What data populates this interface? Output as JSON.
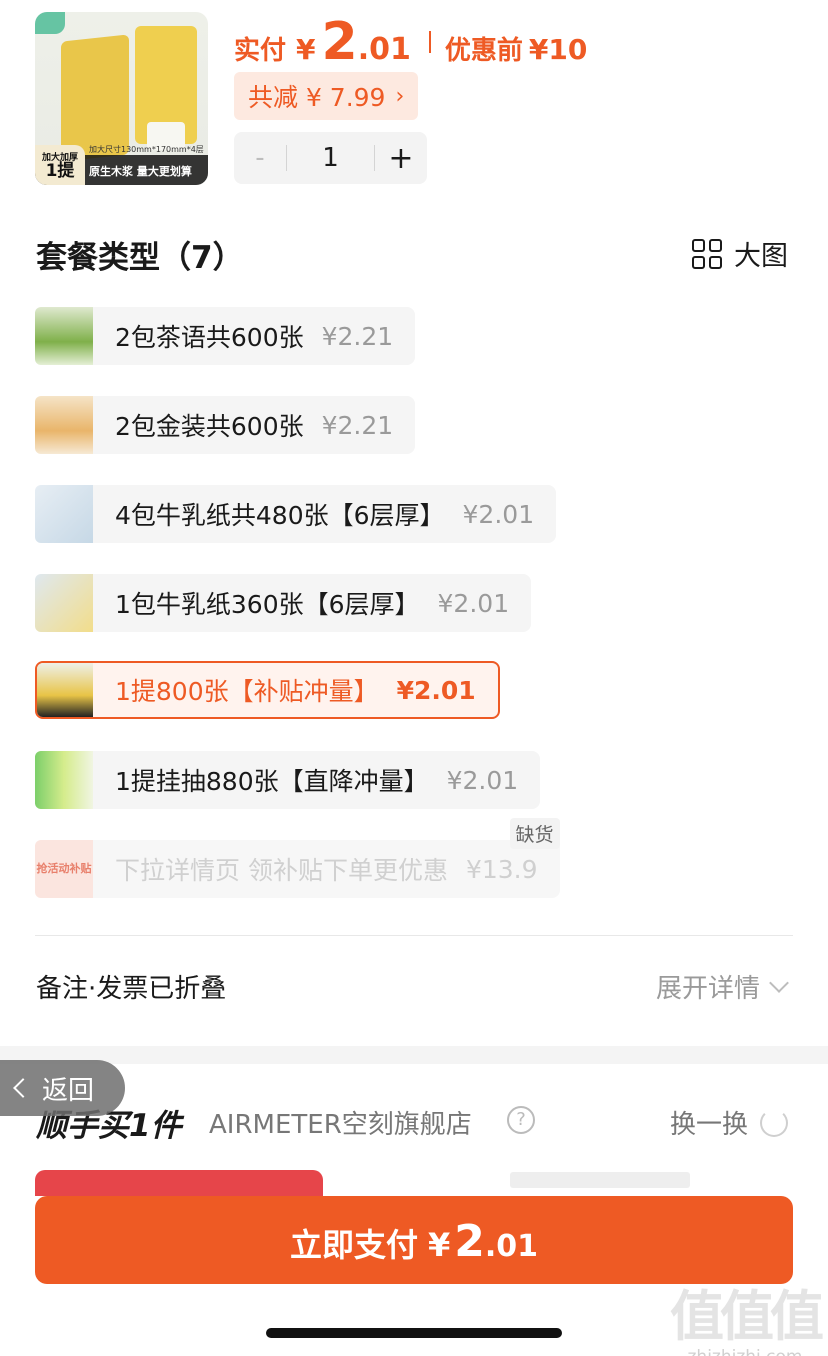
{
  "product": {
    "thumb_badge_small": "加大加厚",
    "thumb_badge_big": "1提",
    "thumb_size": "加大尺寸130mm*170mm*4层",
    "thumb_caption": "原生木浆 量大更划算"
  },
  "price": {
    "label": "实付",
    "currency": "¥",
    "integer": "2",
    "decimal": ".01",
    "original_label": "优惠前",
    "original_value": "¥10"
  },
  "discount": {
    "text": "共减 ¥ 7.99",
    "chevron": "›"
  },
  "stepper": {
    "minus": "-",
    "quantity": "1",
    "plus": "+"
  },
  "package_section": {
    "title": "套餐类型（7）",
    "big_view_label": "大图",
    "options": [
      {
        "name": "2包茶语共600张",
        "price": "¥2.21",
        "state": "normal",
        "thumb": "green-tissue-pack"
      },
      {
        "name": "2包金装共600张",
        "price": "¥2.21",
        "state": "normal",
        "thumb": "gold-tissue-pack"
      },
      {
        "name": "4包牛乳纸共480张【6层厚】",
        "price": "¥2.01",
        "state": "normal",
        "thumb": "milk-tissue-pack"
      },
      {
        "name": "1包牛乳纸360张【6层厚】",
        "price": "¥2.01",
        "state": "normal",
        "thumb": "milk-tissue-single"
      },
      {
        "name": "1提800张【补贴冲量】",
        "price": "¥2.01",
        "state": "selected",
        "thumb": "yellow-tissue-bundle"
      },
      {
        "name": "1提挂抽880张【直降冲量】",
        "price": "¥2.01",
        "state": "normal",
        "thumb": "hanging-tissue-pack"
      },
      {
        "name": "下拉详情页 领补贴下单更优惠",
        "price": "¥13.9",
        "state": "disabled",
        "thumb": "promo-card",
        "thumb_text": "抢活动补贴",
        "badge": "缺货"
      }
    ]
  },
  "remark": {
    "label": "备注·发票已折叠",
    "expand_label": "展开详情"
  },
  "back_button": {
    "label": "返回"
  },
  "buy_along": {
    "title": "顺手买1件",
    "shop_name": "AIRMETER空刻旗舰店",
    "help": "?",
    "swap_label": "换一换"
  },
  "pay_button": {
    "label": "立即支付",
    "currency": "¥",
    "integer": "2",
    "decimal": ".01"
  },
  "watermark": {
    "logo": "值值值",
    "url": "zhizhizhi.com"
  },
  "colors": {
    "accent": "#ee5a24",
    "accent_bg": "#fde9e0",
    "muted_text": "#9a9a9a"
  }
}
